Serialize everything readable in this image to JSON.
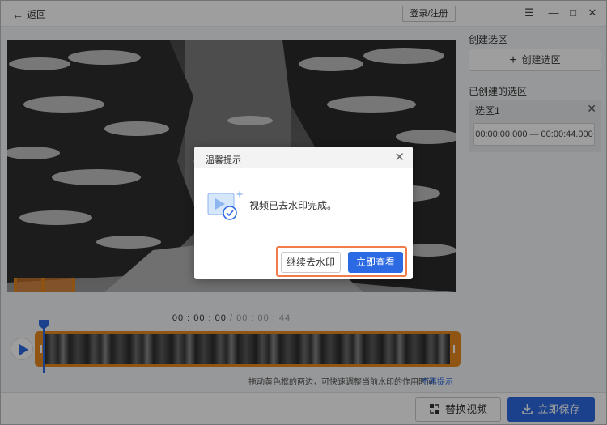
{
  "topbar": {
    "back_label": "返回",
    "login_label": "登录/注册",
    "window_controls": [
      "menu-icon",
      "minimize-icon",
      "maximize-icon",
      "close-icon"
    ]
  },
  "right_panel": {
    "section_title": "创建选区",
    "create_button_label": "创建选区",
    "created_title": "已创建的选区",
    "selections": [
      {
        "name": "选区1",
        "time_range": "00:00:00.000 — 00:00:44.000"
      }
    ]
  },
  "timeline": {
    "current_time": "00 : 00 : 00",
    "separator": " / ",
    "total_time": "00 : 00 : 44",
    "hint": "拖动黄色框的两边，可快速调整当前水印的作用时间",
    "hint_link": "不再提示",
    "accent_color": "#e88a1e"
  },
  "bottombar": {
    "replace_label": "替换视频",
    "save_label": "立即保存"
  },
  "dialog": {
    "title": "温馨提示",
    "message": "视频已去水印完成。",
    "continue_label": "继续去水印",
    "view_label": "立即查看",
    "primary_color": "#2c6ae3",
    "highlight_color": "#f07c4a"
  }
}
